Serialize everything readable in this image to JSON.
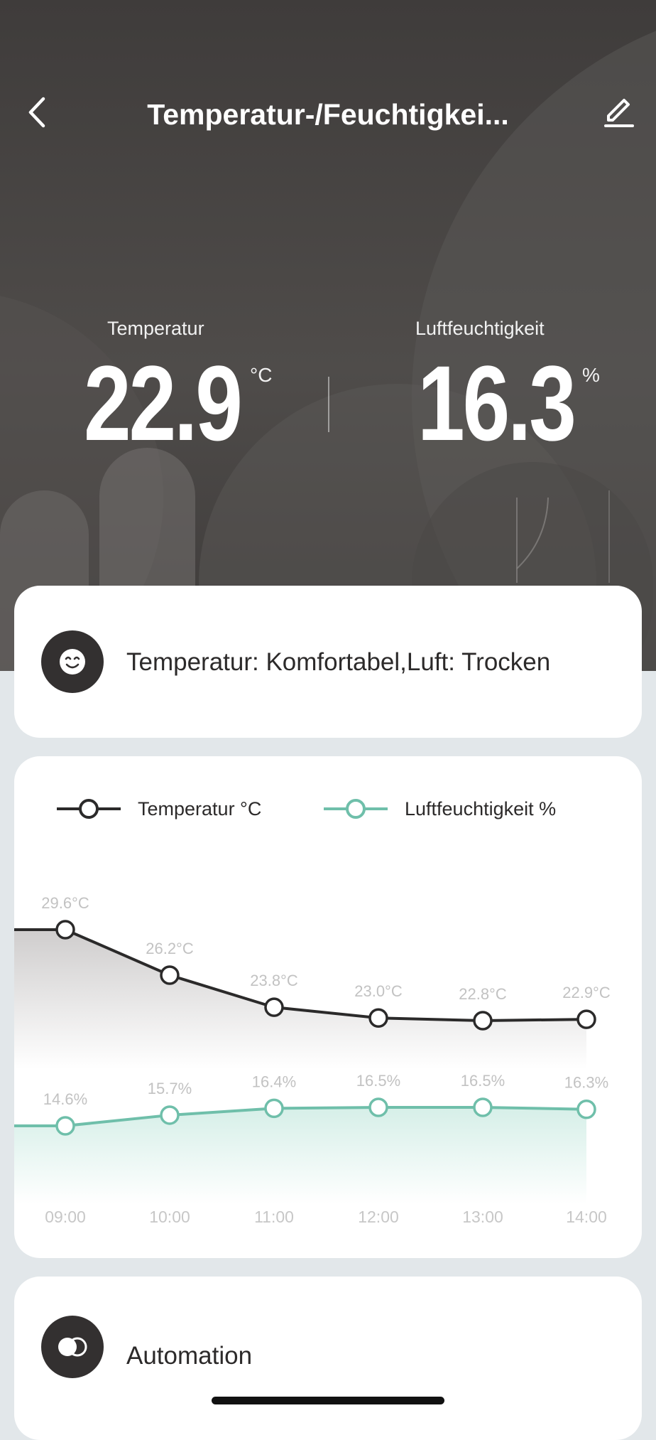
{
  "header": {
    "title": "Temperatur-/Feuchtigkei...",
    "back_icon": "chevron-left-icon",
    "edit_icon": "pencil-icon"
  },
  "metrics": {
    "temperature": {
      "label": "Temperatur",
      "value": "22.9",
      "unit": "°C"
    },
    "humidity": {
      "label": "Luftfeuchtigkeit",
      "value": "16.3",
      "unit": "%"
    }
  },
  "status": {
    "icon": "smiley-face-icon",
    "text": "Temperatur: Komfortabel,Luft: Trocken"
  },
  "legend": {
    "temperature": "Temperatur °C",
    "humidity": "Luftfeuchtigkeit %"
  },
  "chart_data": {
    "type": "line",
    "x": [
      "09:00",
      "10:00",
      "11:00",
      "12:00",
      "13:00",
      "14:00"
    ],
    "series": [
      {
        "name": "Temperatur °C",
        "values": [
          29.6,
          26.2,
          23.8,
          23.0,
          22.8,
          22.9
        ],
        "labels": [
          "29.6°C",
          "26.2°C",
          "23.8°C",
          "23.0°C",
          "22.8°C",
          "22.9°C"
        ],
        "color": "#2b2a2a"
      },
      {
        "name": "Luftfeuchtigkeit %",
        "values": [
          14.6,
          15.7,
          16.4,
          16.5,
          16.5,
          16.3
        ],
        "labels": [
          "14.6%",
          "15.7%",
          "16.4%",
          "16.5%",
          "16.5%",
          "16.3%"
        ],
        "color": "#6fbfaa"
      }
    ]
  },
  "automation": {
    "icon": "toggle-icon",
    "label": "Automation"
  },
  "colors": {
    "dark": "#333030",
    "accent_green": "#6fbfaa",
    "label_gray": "#c2c2c2"
  }
}
